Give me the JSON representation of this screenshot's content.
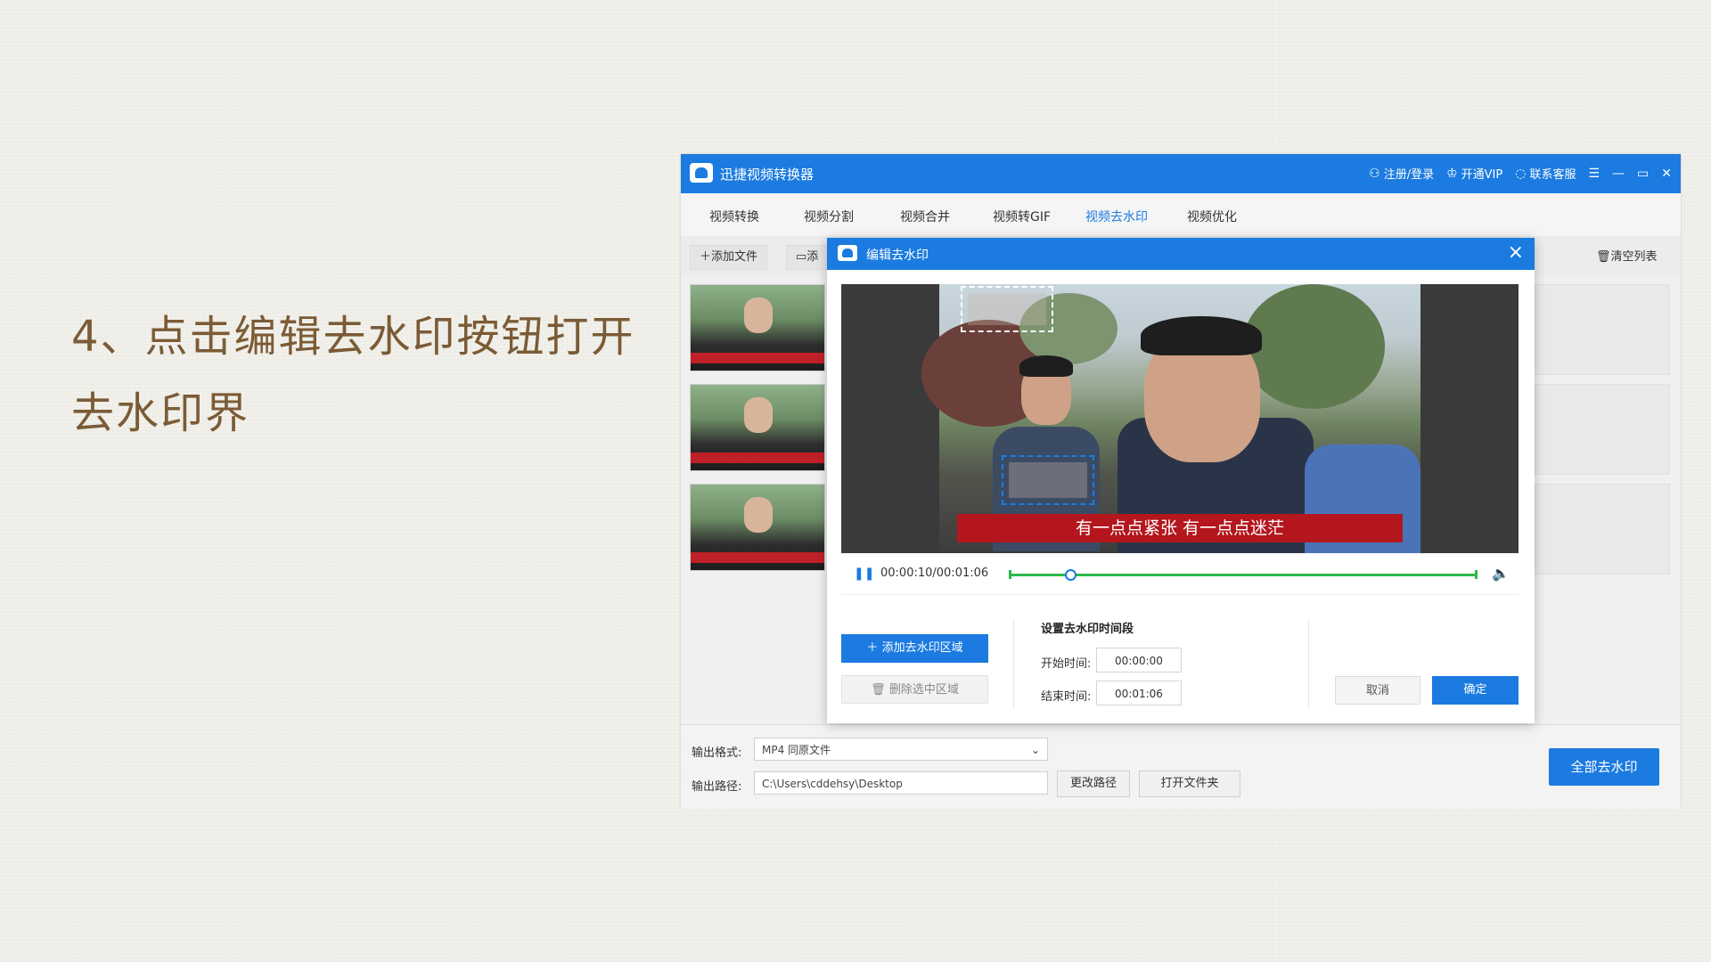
{
  "slide": {
    "line1": "4、点击编辑去水印按钮打开",
    "line2": "去水印界"
  },
  "app": {
    "title": "迅捷视频转换器",
    "login": "注册/登录",
    "vip": "开通VIP",
    "service": "联系客服",
    "tabs": [
      "视频转换",
      "视频分割",
      "视频合并",
      "视频转GIF",
      "视频去水印",
      "视频优化"
    ],
    "active_tab": "视频去水印",
    "add_file": "添加文件",
    "add_folder": "添",
    "clear_list": "清空列表",
    "output_format_label": "输出格式:",
    "output_format_value": "MP4   同原文件",
    "output_path_label": "输出路径:",
    "output_path_value": "C:\\Users\\cddehsy\\Desktop",
    "change_path": "更改路径",
    "open_folder": "打开文件夹",
    "all_remove": "全部去水印"
  },
  "dialog": {
    "title": "编辑去水印",
    "subtitle_text": "有一点点紧张 有一点点迷茫",
    "time": "00:00:10/00:01:06",
    "progress": 0.12,
    "add_area": "添加去水印区域",
    "delete_area": "删除选中区域",
    "set_title": "设置去水印时间段",
    "start_label": "开始时间:",
    "start_value": "00:00:00",
    "end_label": "结束时间:",
    "end_value": "00:01:06",
    "cancel": "取消",
    "ok": "确定"
  },
  "colors": {
    "accent": "#1b7be0",
    "text_brown": "#7b5b36",
    "progress_green": "#2db84b",
    "subtitle_red": "#b4161e"
  }
}
